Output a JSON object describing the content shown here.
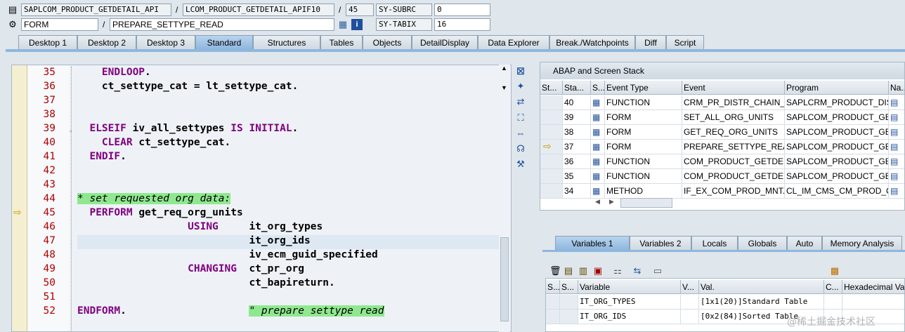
{
  "header": {
    "program": "SAPLCOM_PRODUCT_GETDETAIL_API",
    "include": "LCOM_PRODUCT_GETDETAIL_APIF10",
    "line": "45",
    "subrc_label": "SY-SUBRC",
    "subrc_value": "0",
    "event_type": "FORM",
    "event": "PREPARE_SETTYPE_READ",
    "tabix_label": "SY-TABIX",
    "tabix_value": "16",
    "slash": "/"
  },
  "tabs": [
    "Desktop 1",
    "Desktop 2",
    "Desktop 3",
    "Standard",
    "Structures",
    "Tables",
    "Objects",
    "DetailDisplay",
    "Data Explorer",
    "Break./Watchpoints",
    "Diff",
    "Script"
  ],
  "active_tab": "Standard",
  "code": [
    {
      "n": "35",
      "text": "    ENDLOOP."
    },
    {
      "n": "36",
      "text": "    ct_settype_cat = lt_settype_cat."
    },
    {
      "n": "37",
      "text": ""
    },
    {
      "n": "38",
      "text": ""
    },
    {
      "n": "39",
      "text": "  ELSEIF iv_all_settypes IS INITIAL."
    },
    {
      "n": "40",
      "text": "    CLEAR ct_settype_cat."
    },
    {
      "n": "41",
      "text": "  ENDIF."
    },
    {
      "n": "42",
      "text": ""
    },
    {
      "n": "43",
      "text": ""
    },
    {
      "n": "44",
      "text": "* set requested org data:"
    },
    {
      "n": "45",
      "text": "  PERFORM get_req_org_units"
    },
    {
      "n": "46",
      "text": "                  USING     it_org_types"
    },
    {
      "n": "47",
      "text": "                            it_org_ids"
    },
    {
      "n": "48",
      "text": "                            iv_ecm_guid_specified"
    },
    {
      "n": "49",
      "text": "                  CHANGING  ct_pr_org"
    },
    {
      "n": "50",
      "text": "                            ct_bapireturn."
    },
    {
      "n": "51",
      "text": ""
    },
    {
      "n": "52",
      "text": "ENDFORM.                    \" prepare settype read"
    }
  ],
  "stack": {
    "title": "ABAP and Screen Stack",
    "columns": [
      "St...",
      "Sta...",
      "S...",
      "Event Type",
      "Event",
      "Program",
      "Na..."
    ],
    "rows": [
      {
        "level": "40",
        "type": "FUNCTION",
        "event": "CRM_PR_DISTR_CHAIN_...",
        "program": "SAPLCRM_PRODUCT_DIS..."
      },
      {
        "level": "39",
        "type": "FORM",
        "event": "SET_ALL_ORG_UNITS",
        "program": "SAPLCOM_PRODUCT_GE..."
      },
      {
        "level": "38",
        "type": "FORM",
        "event": "GET_REQ_ORG_UNITS",
        "program": "SAPLCOM_PRODUCT_GE..."
      },
      {
        "level": "37",
        "type": "FORM",
        "event": "PREPARE_SETTYPE_REA...",
        "program": "SAPLCOM_PRODUCT_GE..."
      },
      {
        "level": "36",
        "type": "FUNCTION",
        "event": "COM_PRODUCT_GETDE...",
        "program": "SAPLCOM_PRODUCT_GE..."
      },
      {
        "level": "35",
        "type": "FUNCTION",
        "event": "COM_PRODUCT_GETDE...",
        "program": "SAPLCOM_PRODUCT_GE..."
      },
      {
        "level": "34",
        "type": "METHOD",
        "event": "IF_EX_COM_PROD_MNT...",
        "program": "CL_IM_CMS_CM_PROD_C..."
      }
    ]
  },
  "var_tabs": [
    "Variables 1",
    "Variables 2",
    "Locals",
    "Globals",
    "Auto",
    "Memory Analysis"
  ],
  "variables": {
    "columns": [
      "S...",
      "Variable",
      "V...",
      "Val.",
      "C...",
      "Hexadecimal Va"
    ],
    "rows": [
      {
        "name": "IT_ORG_TYPES",
        "value": "[1x1(20)]Standard Table"
      },
      {
        "name": "IT_ORG_IDS",
        "value": "[0x2(84)]Sorted Table"
      }
    ]
  },
  "watermark": "@稀土掘金技术社区",
  "colors": {
    "keyword": "#800080",
    "comment_bg": "#8fe88f",
    "line_number": "#b00000"
  }
}
